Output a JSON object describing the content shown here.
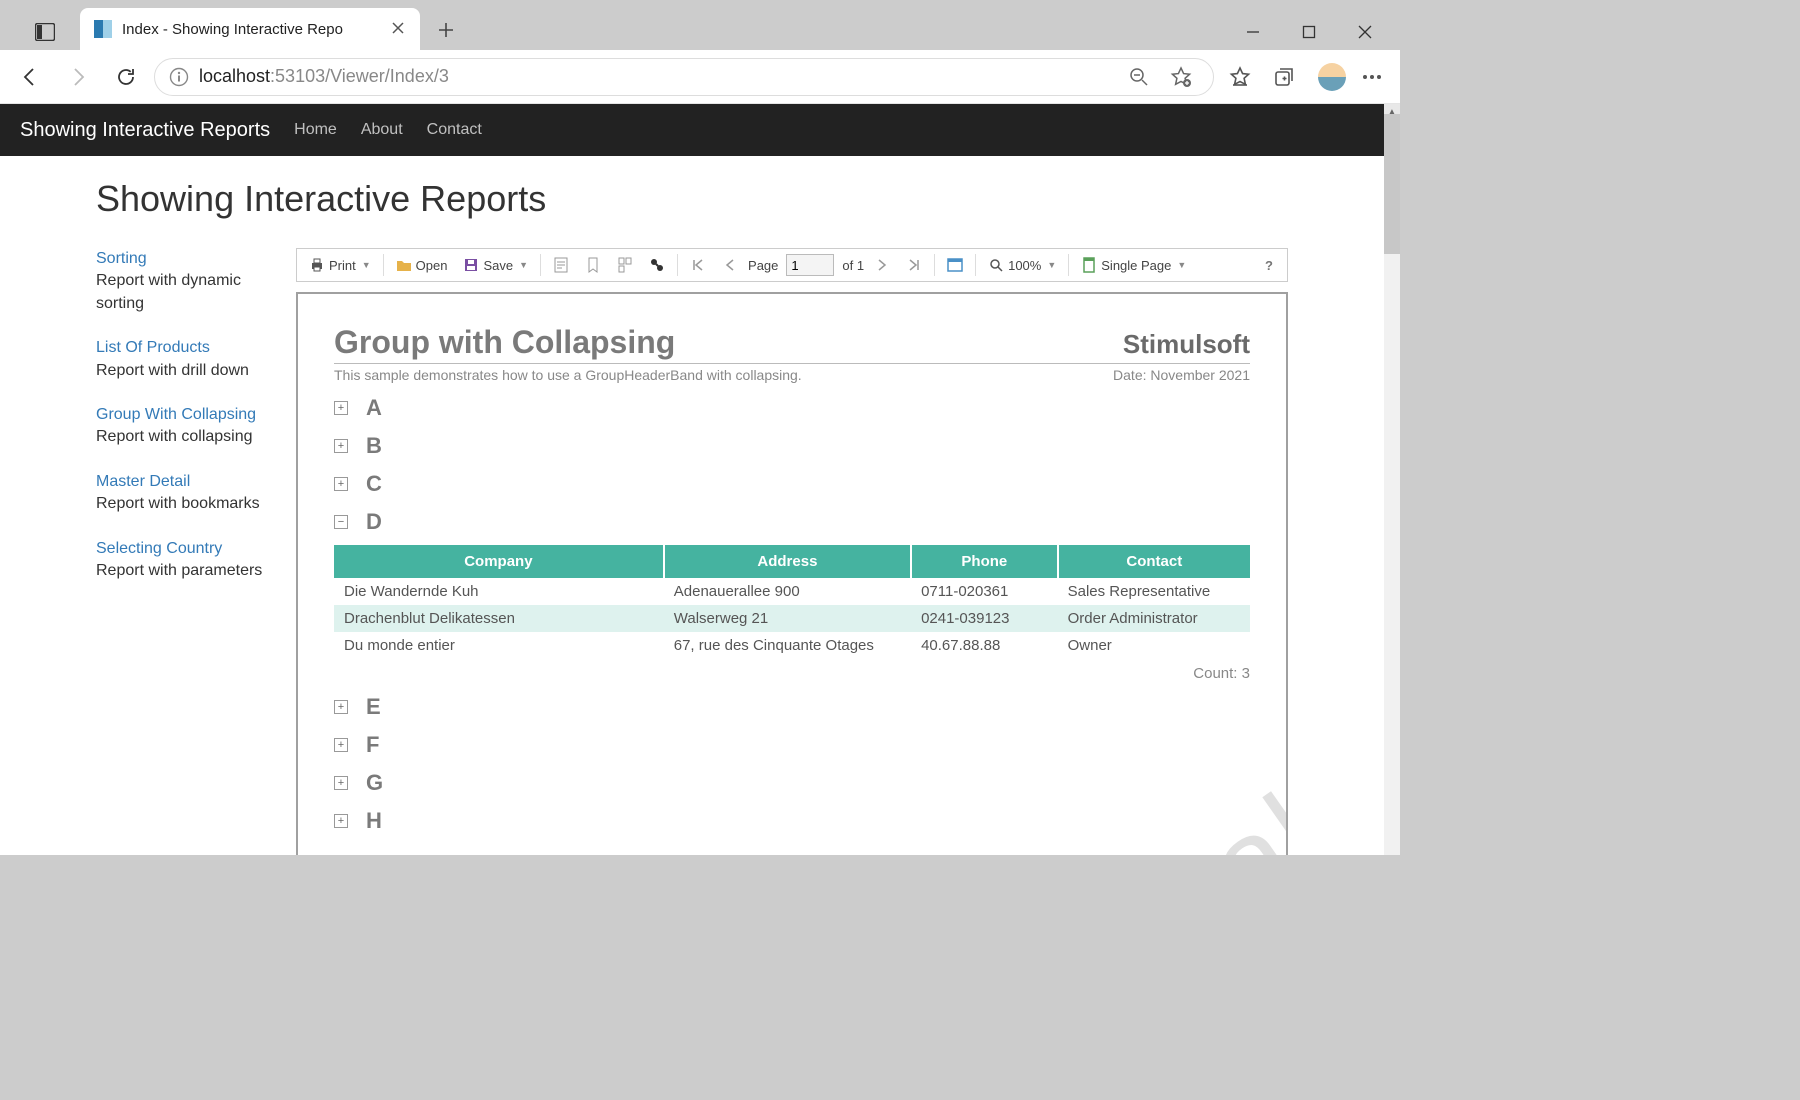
{
  "browser": {
    "tab_title": "Index - Showing Interactive Repo",
    "url_prefix": "localhost",
    "url_suffix": ":53103/Viewer/Index/3"
  },
  "nav": {
    "brand": "Showing Interactive Reports",
    "links": [
      "Home",
      "About",
      "Contact"
    ]
  },
  "page_title": "Showing Interactive Reports",
  "sidebar": [
    {
      "title": "Sorting",
      "desc": "Report with dynamic sorting"
    },
    {
      "title": "List Of Products",
      "desc": "Report with drill down"
    },
    {
      "title": "Group With Collapsing",
      "desc": "Report with collapsing"
    },
    {
      "title": "Master Detail",
      "desc": "Report with bookmarks"
    },
    {
      "title": "Selecting Country",
      "desc": "Report with parameters"
    }
  ],
  "toolbar": {
    "print": "Print",
    "open": "Open",
    "save": "Save",
    "page_label": "Page",
    "page_value": "1",
    "of_label": "of 1",
    "zoom": "100%",
    "viewmode": "Single Page",
    "help": "?"
  },
  "report": {
    "title": "Group with Collapsing",
    "logo": "Stimulsoft",
    "subtitle": "This sample demonstrates how to use a GroupHeaderBand with collapsing.",
    "date": "Date: November 2021",
    "groups_pre": [
      "A",
      "B",
      "C"
    ],
    "expanded_letter": "D",
    "columns": [
      "Company",
      "Address",
      "Phone",
      "Contact"
    ],
    "rows": [
      {
        "company": "Die Wandernde Kuh",
        "address": "Adenauerallee 900",
        "phone": "0711-020361",
        "contact": "Sales Representative"
      },
      {
        "company": "Drachenblut Delikatessen",
        "address": "Walserweg 21",
        "phone": "0241-039123",
        "contact": "Order Administrator"
      },
      {
        "company": "Du monde entier",
        "address": "67, rue des Cinquante Otages",
        "phone": "40.67.88.88",
        "contact": "Owner"
      }
    ],
    "count_label": "Count: 3",
    "groups_post": [
      "E",
      "F",
      "G",
      "H"
    ]
  }
}
